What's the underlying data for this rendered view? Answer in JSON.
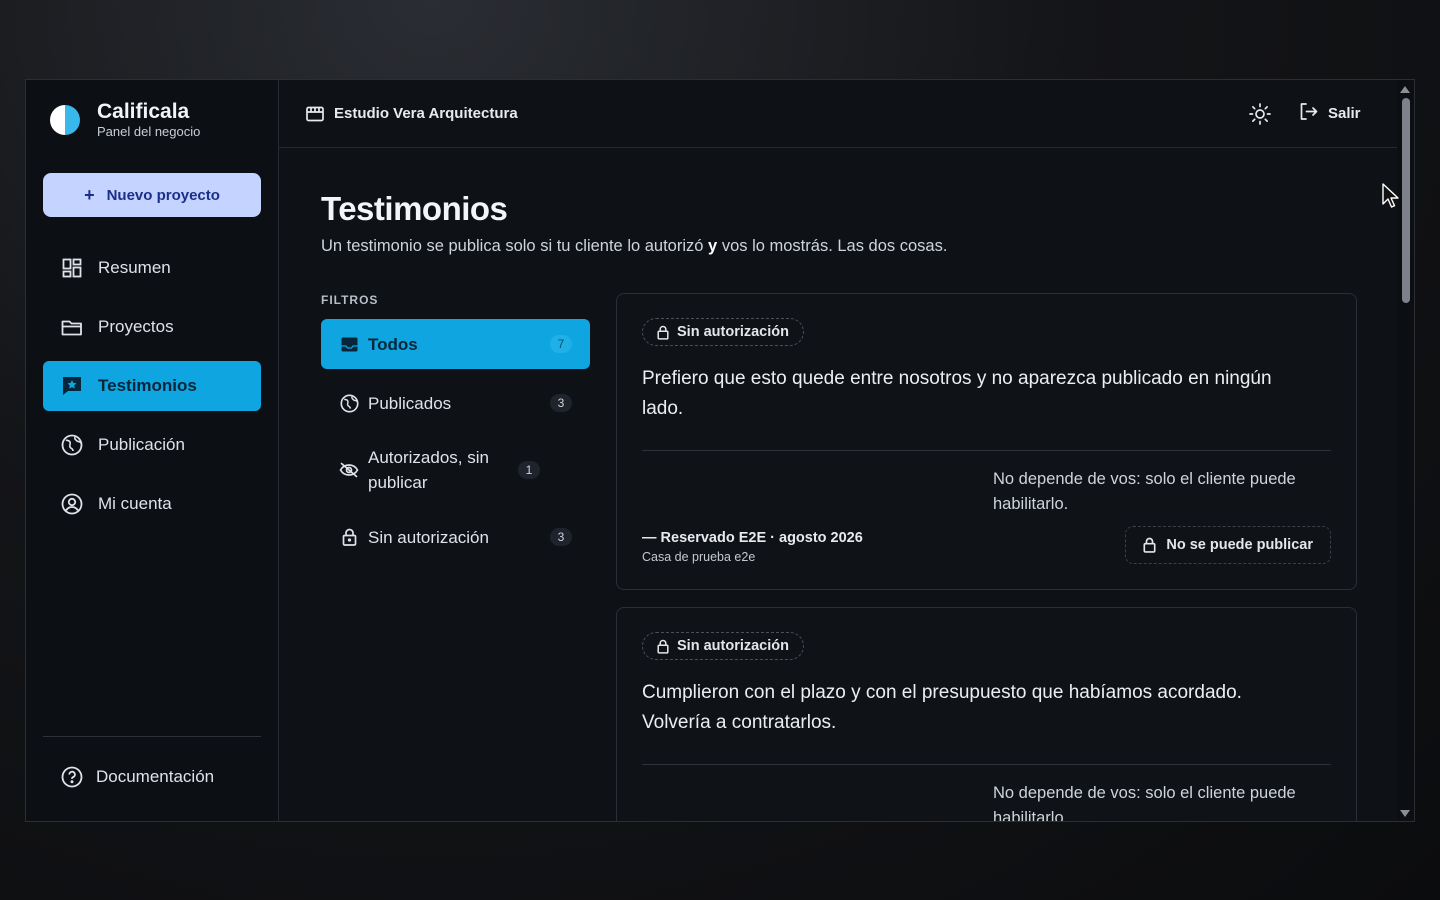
{
  "brand": {
    "name": "Calificala",
    "subtitle": "Panel del negocio"
  },
  "sidebar": {
    "new_project_label": "Nuevo proyecto",
    "items": [
      {
        "label": "Resumen",
        "icon": "dashboard-icon"
      },
      {
        "label": "Proyectos",
        "icon": "folder-icon"
      },
      {
        "label": "Testimonios",
        "icon": "chat-star-icon",
        "active": true
      },
      {
        "label": "Publicación",
        "icon": "globe-icon"
      },
      {
        "label": "Mi cuenta",
        "icon": "user-circle-icon"
      }
    ],
    "docs_label": "Documentación"
  },
  "header": {
    "workspace": "Estudio Vera Arquitectura",
    "logout_label": "Salir"
  },
  "page": {
    "title": "Testimonios",
    "description_pre": "Un testimonio se publica solo si tu cliente lo autorizó",
    "description_bold": "y",
    "description_post": "vos lo mostrás. Las dos cosas."
  },
  "filters": {
    "label": "FILTROS",
    "items": [
      {
        "label": "Todos",
        "count": "7",
        "icon": "inbox-icon",
        "active": true
      },
      {
        "label": "Publicados",
        "count": "3",
        "icon": "globe-icon"
      },
      {
        "label": "Autorizados, sin publicar",
        "count": "1",
        "icon": "eye-off-icon"
      },
      {
        "label": "Sin autorización",
        "count": "3",
        "icon": "lock-icon"
      }
    ]
  },
  "testimonials": [
    {
      "status": "Sin autorización",
      "quote": "Prefiero que esto quede entre nosotros y no aparezca publicado en ningún lado.",
      "note": "No depende de vos: solo el cliente puede habilitarlo.",
      "author": "— Reservado E2E · agosto 2026",
      "project": "Casa de prueba e2e",
      "action_label": "No se puede publicar"
    },
    {
      "status": "Sin autorización",
      "quote": "Cumplieron con el plazo y con el presupuesto que habíamos acordado. Volvería a contratarlos.",
      "note": "No depende de vos: solo el cliente puede habilitarlo."
    }
  ],
  "colors": {
    "accent": "#0ea5e0",
    "primary_button": "#c4d3ff",
    "background": "#0e1116"
  }
}
